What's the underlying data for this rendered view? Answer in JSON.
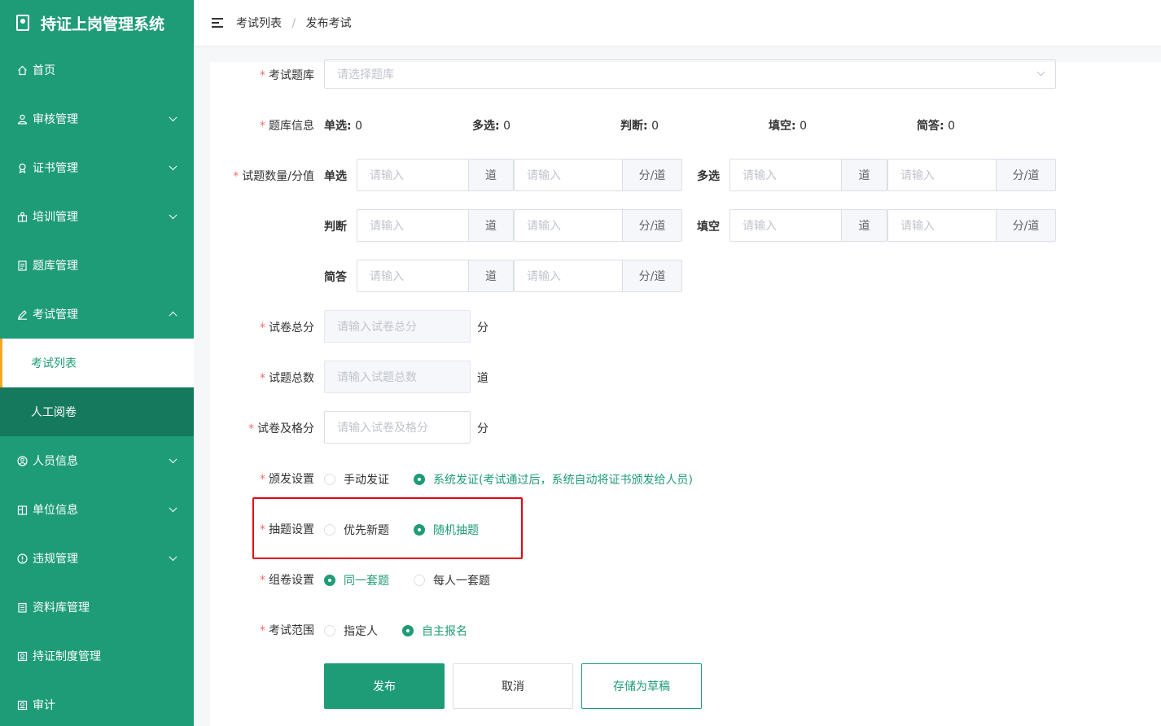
{
  "app": {
    "title": "持证上岗管理系统"
  },
  "sidebar": {
    "items": [
      {
        "label": "首页",
        "icon": "home-icon"
      },
      {
        "label": "审核管理",
        "icon": "user-icon"
      },
      {
        "label": "证书管理",
        "icon": "certificate-icon"
      },
      {
        "label": "培训管理",
        "icon": "training-icon"
      },
      {
        "label": "题库管理",
        "icon": "document-icon"
      },
      {
        "label": "考试管理",
        "icon": "edit-icon"
      },
      {
        "label": "考试列表"
      },
      {
        "label": "人工阅卷"
      },
      {
        "label": "人员信息",
        "icon": "person-circle-icon"
      },
      {
        "label": "单位信息",
        "icon": "building-icon"
      },
      {
        "label": "违规管理",
        "icon": "warning-icon"
      },
      {
        "label": "资料库管理",
        "icon": "folder-icon"
      },
      {
        "label": "持证制度管理",
        "icon": "policy-icon"
      },
      {
        "label": "审计",
        "icon": "audit-icon"
      }
    ]
  },
  "breadcrumb": {
    "parent": "考试列表",
    "separator": "/",
    "current": "发布考试"
  },
  "form": {
    "bank": {
      "label": "考试题库",
      "placeholder": "请选择题库"
    },
    "bank_info": {
      "label": "题库信息",
      "items": [
        {
          "name": "单选:",
          "value": "0"
        },
        {
          "name": "多选:",
          "value": "0"
        },
        {
          "name": "判断:",
          "value": "0"
        },
        {
          "name": "填空:",
          "value": "0"
        },
        {
          "name": "简答:",
          "value": "0"
        }
      ]
    },
    "quantity": {
      "label": "试题数量/分值",
      "placeholder": "请输入",
      "unit_count": "道",
      "unit_score": "分/道",
      "types": [
        "单选",
        "多选",
        "判断",
        "填空",
        "简答"
      ]
    },
    "total_score": {
      "label": "试卷总分",
      "placeholder": "请输入试卷总分",
      "unit": "分"
    },
    "total_count": {
      "label": "试题总数",
      "placeholder": "请输入试题总数",
      "unit": "道"
    },
    "pass_score": {
      "label": "试卷及格分",
      "placeholder": "请输入试卷及格分",
      "unit": "分"
    },
    "issue": {
      "label": "颁发设置",
      "options": [
        "手动发证",
        "系统发证(考试通过后，系统自动将证书颁发给人员)"
      ],
      "selected": 1
    },
    "draw": {
      "label": "抽题设置",
      "options": [
        "优先新题",
        "随机抽题"
      ],
      "selected": 1
    },
    "compose": {
      "label": "组卷设置",
      "options": [
        "同一套题",
        "每人一套题"
      ],
      "selected": 0
    },
    "scope": {
      "label": "考试范围",
      "options": [
        "指定人",
        "自主报名"
      ],
      "selected": 1
    },
    "required_mark": "*"
  },
  "buttons": {
    "publish": "发布",
    "cancel": "取消",
    "draft": "存储为草稿"
  },
  "colors": {
    "primary": "#1e9c77",
    "highlight": "#e60012",
    "active_border": "#f5a623"
  }
}
